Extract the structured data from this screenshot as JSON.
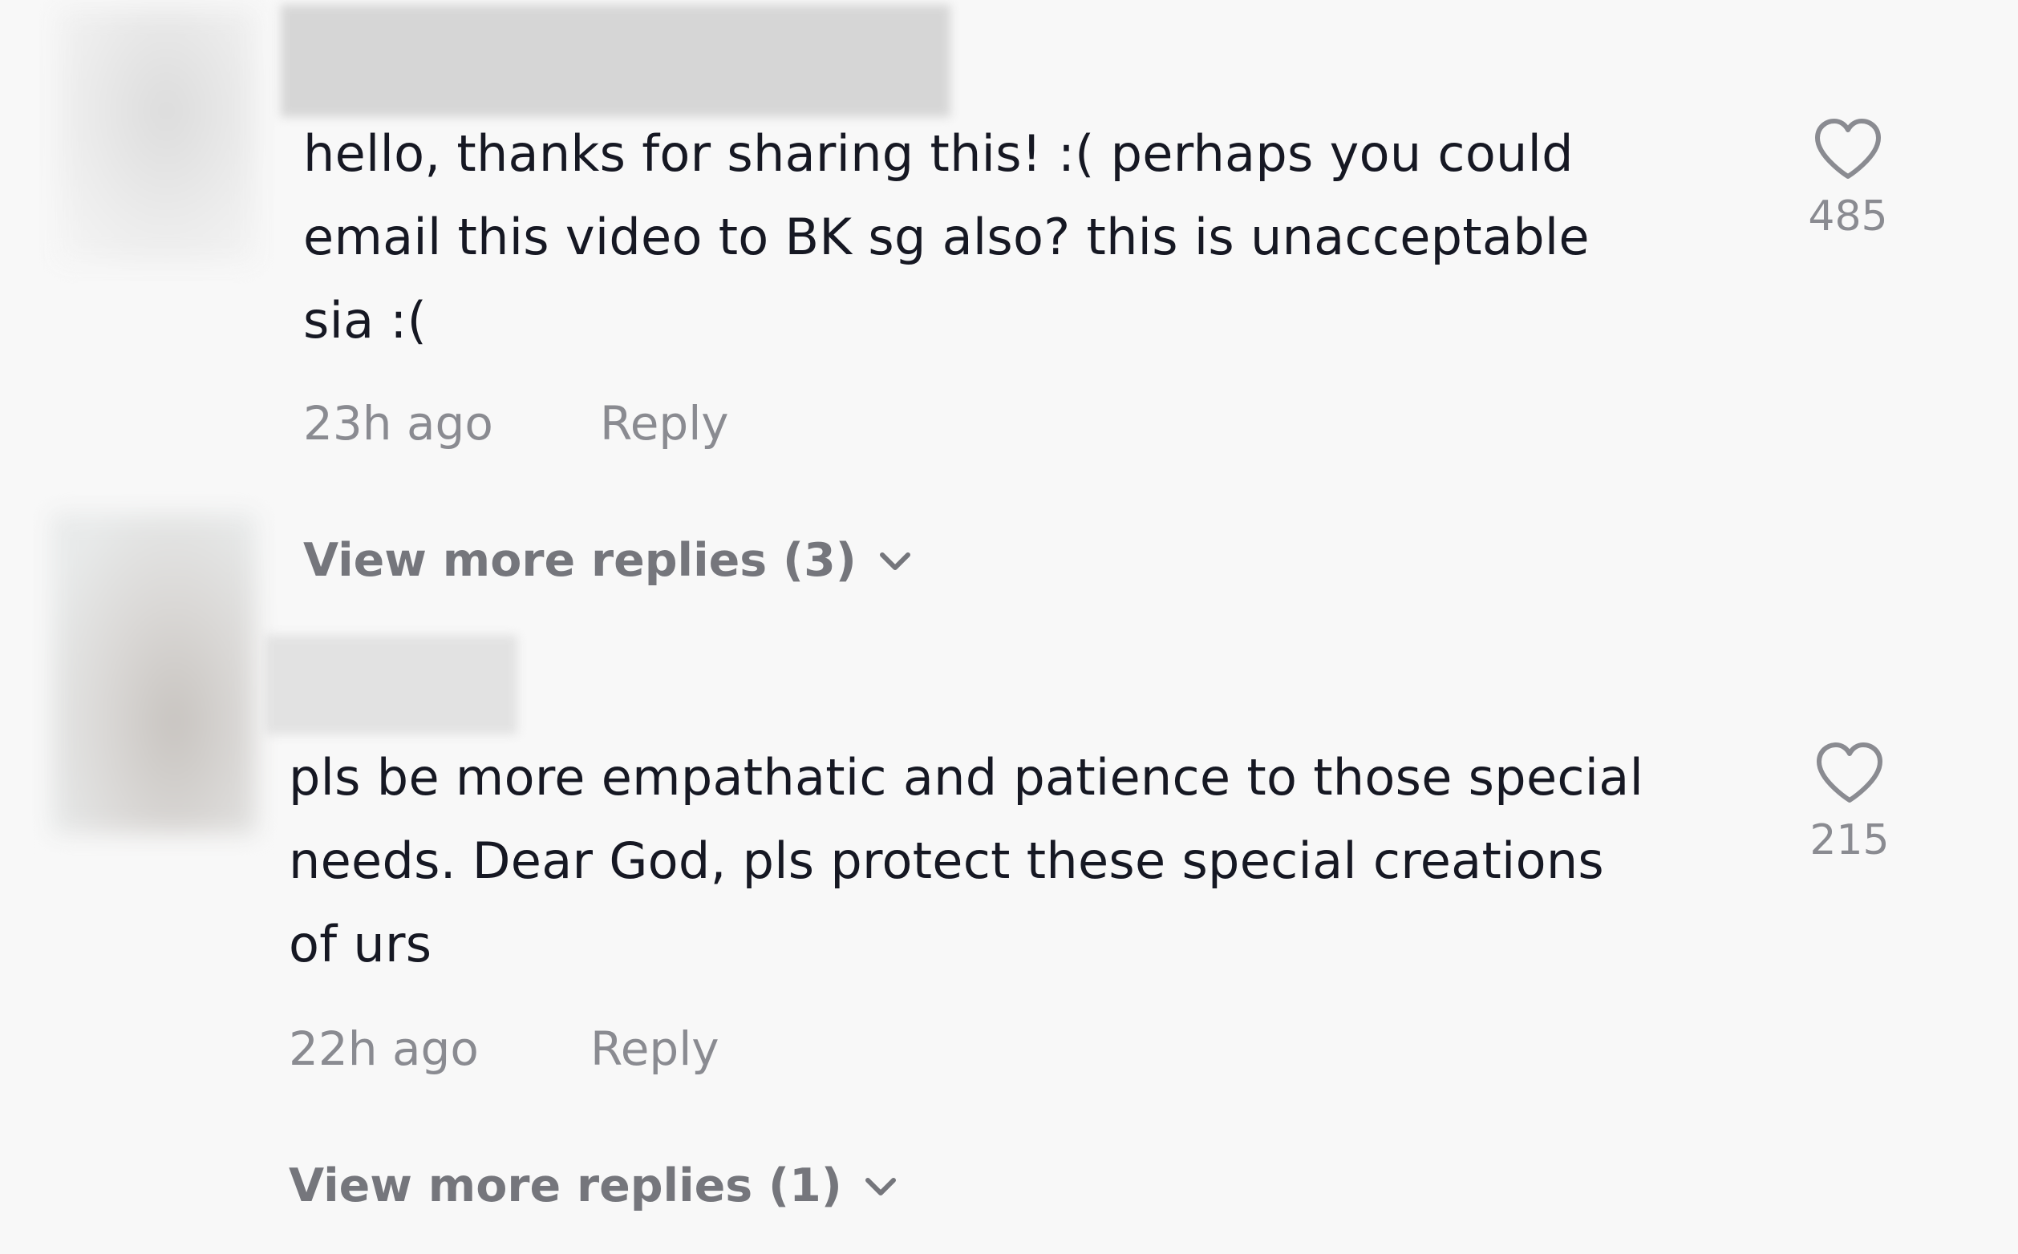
{
  "comments": [
    {
      "text": "hello, thanks for sharing this! :( perhaps you could\nemail this video to BK sg also? this is unacceptable\nsia :(",
      "time": "23h ago",
      "reply_label": "Reply",
      "like_count": "485",
      "view_more": "View more replies (3)"
    },
    {
      "text": "pls be more empathatic and patience to those special\nneeds. Dear God, pls protect these special creations\nof urs",
      "time": "22h ago",
      "reply_label": "Reply",
      "like_count": "215",
      "view_more": "View more replies (1)"
    }
  ],
  "icons": {
    "like": "heart-outline-icon",
    "expand": "chevron-down-icon"
  },
  "colors": {
    "background": "#f8f8f8",
    "text": "#161823",
    "muted": "#8a8b91"
  }
}
